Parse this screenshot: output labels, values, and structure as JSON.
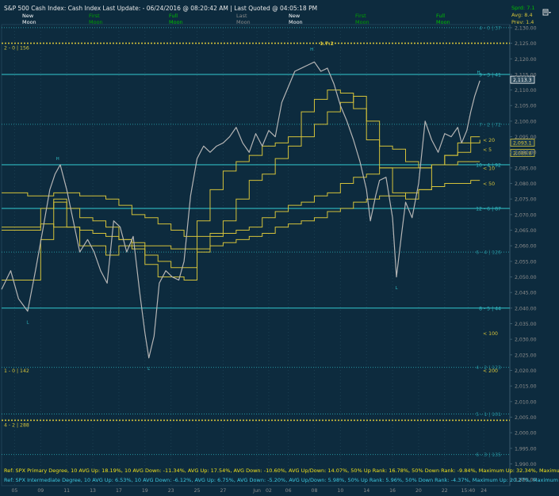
{
  "header": {
    "title": "S&P 500 Cash Index:  Cash Index  Last Update: - 06/24/2016 @ 08:20:42 AM | Last Quoted @ 04:05:18 PM",
    "menu_icon": "menu-list-icon",
    "stats": [
      "Sprd: 7.1",
      "Avg: 8.4",
      "Prev: 1.4"
    ]
  },
  "moon_phases": [
    {
      "top": "New",
      "bottom": "Moon",
      "color": "#ffffff"
    },
    {
      "top": "First",
      "bottom": "Moon",
      "color": "#00a000"
    },
    {
      "top": "Full",
      "bottom": "Moon",
      "color": "#00c000"
    },
    {
      "top": "Last",
      "bottom": "Moon",
      "color": "#8a8a8a"
    },
    {
      "top": "New",
      "bottom": "Moon",
      "color": "#ffffff"
    },
    {
      "top": "First",
      "bottom": "Moon",
      "color": "#00a000"
    },
    {
      "top": "Full",
      "bottom": "Moon",
      "color": "#00c000"
    }
  ],
  "colors": {
    "background": "#0d2b3e",
    "cyan": "#2fb8c0",
    "yellow": "#d4c23a",
    "price": "#b5b5b5",
    "axis_text": "#8c8c8c",
    "ref_primary": "#f0e01a",
    "ref_intermediate": "#3ec8e0"
  },
  "chart_data": {
    "type": "line",
    "title": "S&P 500 Cash Index",
    "ylim": [
      1983,
      2131
    ],
    "y_ticks": [
      2130,
      2125,
      2120,
      2115,
      2110,
      2105,
      2100,
      2095,
      2090,
      2085,
      2080,
      2075,
      2070,
      2065,
      2060,
      2055,
      2050,
      2045,
      2040,
      2035,
      2030,
      2025,
      2020,
      2015,
      2010,
      2005,
      2000,
      1995,
      1990,
      1985
    ],
    "x_ticks": [
      {
        "label": "05",
        "i": 1
      },
      {
        "label": "09",
        "i": 3
      },
      {
        "label": "11",
        "i": 5
      },
      {
        "label": "13",
        "i": 7
      },
      {
        "label": "17",
        "i": 9
      },
      {
        "label": "19",
        "i": 11
      },
      {
        "label": "23",
        "i": 13
      },
      {
        "label": "25",
        "i": 15
      },
      {
        "label": "27",
        "i": 17
      },
      {
        "label": "Jun",
        "i": 19.6
      },
      {
        "label": "02",
        "i": 20.5
      },
      {
        "label": "06",
        "i": 22
      },
      {
        "label": "08",
        "i": 24
      },
      {
        "label": "10",
        "i": 26
      },
      {
        "label": "14",
        "i": 28
      },
      {
        "label": "16",
        "i": 30
      },
      {
        "label": "20",
        "i": 32
      },
      {
        "label": "22",
        "i": 34
      },
      {
        "label": "15:40",
        "i": 35.8
      },
      {
        "label": "24",
        "i": 37
      }
    ],
    "index_range": [
      0,
      39
    ],
    "price_series": {
      "name": "Price",
      "points": [
        [
          0,
          2046
        ],
        [
          0.7,
          2052
        ],
        [
          1.3,
          2043
        ],
        [
          2,
          2039
        ],
        [
          2.6,
          2052
        ],
        [
          3.2,
          2066
        ],
        [
          3.7,
          2078
        ],
        [
          4.1,
          2083
        ],
        [
          4.5,
          2086
        ],
        [
          5,
          2078
        ],
        [
          5.5,
          2068
        ],
        [
          6,
          2058
        ],
        [
          6.6,
          2062
        ],
        [
          7.1,
          2058
        ],
        [
          7.6,
          2052
        ],
        [
          8.1,
          2048
        ],
        [
          8.6,
          2068
        ],
        [
          9.1,
          2066
        ],
        [
          9.6,
          2058
        ],
        [
          10.1,
          2063
        ],
        [
          10.6,
          2045
        ],
        [
          11,
          2032
        ],
        [
          11.3,
          2024
        ],
        [
          11.7,
          2031
        ],
        [
          12.1,
          2048
        ],
        [
          12.6,
          2052
        ],
        [
          13.1,
          2050
        ],
        [
          13.6,
          2049
        ],
        [
          14,
          2055
        ],
        [
          14.5,
          2076
        ],
        [
          15,
          2088
        ],
        [
          15.5,
          2092
        ],
        [
          16,
          2090
        ],
        [
          16.5,
          2092
        ],
        [
          17,
          2093
        ],
        [
          17.5,
          2095
        ],
        [
          18,
          2098
        ],
        [
          18.5,
          2093
        ],
        [
          19,
          2090
        ],
        [
          19.5,
          2096
        ],
        [
          20,
          2092
        ],
        [
          20.5,
          2097
        ],
        [
          21,
          2095
        ],
        [
          21.5,
          2106
        ],
        [
          22,
          2111
        ],
        [
          22.5,
          2116
        ],
        [
          23,
          2117
        ],
        [
          23.5,
          2118
        ],
        [
          24,
          2119
        ],
        [
          24.5,
          2116
        ],
        [
          25,
          2117
        ],
        [
          25.5,
          2112
        ],
        [
          26,
          2105
        ],
        [
          26.5,
          2100
        ],
        [
          27,
          2094
        ],
        [
          27.5,
          2087
        ],
        [
          28,
          2078
        ],
        [
          28.3,
          2068
        ],
        [
          28.7,
          2076
        ],
        [
          29,
          2081
        ],
        [
          29.5,
          2082
        ],
        [
          30,
          2069
        ],
        [
          30.3,
          2050
        ],
        [
          30.7,
          2064
        ],
        [
          31,
          2074
        ],
        [
          31.5,
          2069
        ],
        [
          32,
          2080
        ],
        [
          32.5,
          2100
        ],
        [
          33,
          2094
        ],
        [
          33.5,
          2090
        ],
        [
          34,
          2096
        ],
        [
          34.5,
          2095
        ],
        [
          35,
          2098
        ],
        [
          35.3,
          2093
        ],
        [
          35.7,
          2097
        ],
        [
          36,
          2103
        ],
        [
          36.3,
          2108
        ],
        [
          36.7,
          2113
        ]
      ],
      "labels": [
        {
          "text": "H",
          "i": 4.3,
          "y": 2087.3,
          "pos": "above"
        },
        {
          "text": "L",
          "i": 2,
          "y": 2036.5,
          "pos": "below"
        },
        {
          "text": "L",
          "i": 11.3,
          "y": 2021.7,
          "pos": "below"
        },
        {
          "text": "H",
          "i": 23.8,
          "y": 2122.4,
          "pos": "above"
        },
        {
          "text": "L",
          "i": 30.3,
          "y": 2047.6,
          "pos": "below"
        },
        {
          "text": "H",
          "i": 36.6,
          "y": 2115,
          "pos": "above"
        }
      ]
    },
    "moving_averages": [
      {
        "label": "< 5",
        "label_y": 2091.0,
        "points": [
          [
            0,
            2049
          ],
          [
            1,
            2049
          ],
          [
            2,
            2049
          ],
          [
            3,
            2062
          ],
          [
            4,
            2074
          ],
          [
            5,
            2066
          ],
          [
            6,
            2060
          ],
          [
            7,
            2060
          ],
          [
            8,
            2057
          ],
          [
            9,
            2060
          ],
          [
            10,
            2060
          ],
          [
            11,
            2054
          ],
          [
            12,
            2050
          ],
          [
            13,
            2050
          ],
          [
            14,
            2049
          ],
          [
            15,
            2068
          ],
          [
            16,
            2078
          ],
          [
            17,
            2084
          ],
          [
            18,
            2087
          ],
          [
            19,
            2089
          ],
          [
            20,
            2092
          ],
          [
            21,
            2093
          ],
          [
            22,
            2095
          ],
          [
            23,
            2103
          ],
          [
            24,
            2107
          ],
          [
            25,
            2110
          ],
          [
            26,
            2109
          ],
          [
            27,
            2104
          ],
          [
            28,
            2094
          ],
          [
            29,
            2085
          ],
          [
            30,
            2077
          ],
          [
            31,
            2075
          ],
          [
            32,
            2078
          ],
          [
            33,
            2086
          ],
          [
            34,
            2089
          ],
          [
            35,
            2093
          ],
          [
            36,
            2095
          ],
          [
            36.7,
            2095
          ]
        ]
      },
      {
        "label": "< 10",
        "label_y": 2085.0,
        "points": [
          [
            0,
            2065
          ],
          [
            1,
            2065
          ],
          [
            2,
            2065
          ],
          [
            3,
            2072
          ],
          [
            4,
            2075
          ],
          [
            5,
            2072
          ],
          [
            6,
            2069
          ],
          [
            7,
            2068
          ],
          [
            8,
            2066
          ],
          [
            9,
            2062
          ],
          [
            10,
            2059
          ],
          [
            11,
            2057
          ],
          [
            12,
            2055
          ],
          [
            13,
            2053
          ],
          [
            14,
            2053
          ],
          [
            15,
            2058
          ],
          [
            16,
            2063
          ],
          [
            17,
            2068
          ],
          [
            18,
            2075
          ],
          [
            19,
            2081
          ],
          [
            20,
            2083
          ],
          [
            21,
            2088
          ],
          [
            22,
            2092
          ],
          [
            23,
            2095
          ],
          [
            24,
            2099
          ],
          [
            25,
            2103
          ],
          [
            26,
            2106
          ],
          [
            27,
            2108
          ],
          [
            28,
            2100
          ],
          [
            29,
            2092
          ],
          [
            30,
            2091
          ],
          [
            31,
            2087
          ],
          [
            32,
            2085
          ],
          [
            33,
            2086
          ],
          [
            34,
            2086
          ],
          [
            35,
            2087
          ],
          [
            36,
            2087
          ],
          [
            36.7,
            2087
          ]
        ]
      },
      {
        "label": "< 20",
        "label_y": 2094.0,
        "points": [
          [
            0,
            2077
          ],
          [
            1,
            2077
          ],
          [
            2,
            2076
          ],
          [
            3,
            2076
          ],
          [
            4,
            2077
          ],
          [
            5,
            2077
          ],
          [
            6,
            2076
          ],
          [
            7,
            2076
          ],
          [
            8,
            2075
          ],
          [
            9,
            2073
          ],
          [
            10,
            2070
          ],
          [
            11,
            2069
          ],
          [
            12,
            2067
          ],
          [
            13,
            2065
          ],
          [
            14,
            2063
          ],
          [
            15,
            2063
          ],
          [
            16,
            2064
          ],
          [
            17,
            2064
          ],
          [
            18,
            2065
          ],
          [
            19,
            2066
          ],
          [
            20,
            2069
          ],
          [
            21,
            2071
          ],
          [
            22,
            2073
          ],
          [
            23,
            2074
          ],
          [
            24,
            2076
          ],
          [
            25,
            2077
          ],
          [
            26,
            2080
          ],
          [
            27,
            2082
          ],
          [
            28,
            2083
          ],
          [
            29,
            2085
          ],
          [
            30,
            2085
          ],
          [
            31,
            2085
          ],
          [
            32,
            2085
          ],
          [
            33,
            2086
          ],
          [
            34,
            2089
          ],
          [
            35,
            2090
          ],
          [
            36,
            2093
          ],
          [
            36.7,
            2094
          ]
        ]
      },
      {
        "label": "< 50",
        "label_y": 2080.0,
        "points": [
          [
            0,
            2066
          ],
          [
            1,
            2066
          ],
          [
            2,
            2066
          ],
          [
            3,
            2067
          ],
          [
            4,
            2066
          ],
          [
            5,
            2066
          ],
          [
            6,
            2065
          ],
          [
            7,
            2064
          ],
          [
            8,
            2063
          ],
          [
            9,
            2062
          ],
          [
            10,
            2061
          ],
          [
            11,
            2060
          ],
          [
            12,
            2060
          ],
          [
            13,
            2059
          ],
          [
            14,
            2059
          ],
          [
            15,
            2059
          ],
          [
            16,
            2060
          ],
          [
            17,
            2061
          ],
          [
            18,
            2062
          ],
          [
            19,
            2063
          ],
          [
            20,
            2064
          ],
          [
            21,
            2066
          ],
          [
            22,
            2067
          ],
          [
            23,
            2068
          ],
          [
            24,
            2069
          ],
          [
            25,
            2071
          ],
          [
            26,
            2072
          ],
          [
            27,
            2074
          ],
          [
            28,
            2075
          ],
          [
            29,
            2076
          ],
          [
            30,
            2076
          ],
          [
            31,
            2077
          ],
          [
            32,
            2078
          ],
          [
            33,
            2079
          ],
          [
            34,
            2080
          ],
          [
            35,
            2080
          ],
          [
            36,
            2081
          ],
          [
            36.7,
            2081
          ]
        ]
      }
    ],
    "cyan_levels": [
      {
        "label": "9 - 3 | 41",
        "y": 2115,
        "style": "solid"
      },
      {
        "label": "10 - 4 | 92",
        "y": 2086,
        "style": "solid"
      },
      {
        "label": "12 - 6 | 87",
        "y": 2072,
        "style": "solid"
      },
      {
        "label": "8 - 5 | 44",
        "y": 2040,
        "style": "solid"
      },
      {
        "label": "4 - 0 | 37",
        "y": 2130,
        "style": "dotted"
      },
      {
        "label": "7 - 2 | 72",
        "y": 2099,
        "style": "dotted"
      },
      {
        "label": "6 - 4 | 126",
        "y": 2058,
        "style": "dotted"
      },
      {
        "label": "4 - 2 | 123",
        "y": 2021,
        "style": "dotted"
      },
      {
        "label": "5 - 1 | 101",
        "y": 2006,
        "style": "dotted"
      },
      {
        "label": "6 - 3 | 135",
        "y": 1993,
        "style": "dotted"
      }
    ],
    "yellow_levels": [
      {
        "label": "2 - 0 | 156",
        "y": 2125,
        "style": "dotted"
      },
      {
        "label": "4 - 2 | 288",
        "y": 2004,
        "style": "dotted"
      }
    ],
    "level_markers": [
      {
        "label": "< 100",
        "y": 2032
      },
      {
        "label": "< 200",
        "y": 2020
      }
    ],
    "top_marker": "1.7.2",
    "price_labels": [
      {
        "text": "2,113.3",
        "y": 2113.3,
        "color": "#ffffff"
      },
      {
        "text": "2,093.1",
        "y": 2093.1,
        "color": "#d4c23a"
      },
      {
        "text": "2,089.8",
        "y": 2089.8,
        "color": "#d4c23a"
      }
    ],
    "left_labels": [
      {
        "text": "1 - 0 | 142",
        "y": 2020,
        "color": "#d4c23a"
      }
    ]
  },
  "references": [
    "Ref: SPX Primary Degree, 10 AVG Up: 18.19%, 10 AVG Down: -11.34%, AVG Up: 17.54%, AVG Down: -10.60%, AVG Up/Down: 14.07%, 50%  Up Rank: 16.78%, 50% Down Rank: -9.84%, Maximum Up: 32.34%, Maximum",
    "Ref: SPX Intermediate Degree, 10 AVG Up: 6.53%, 10 AVG Down: -6.12%, AVG Up: 6.75%, AVG Down: -5.20%, AVG Up/Down: 5.98%, 50%  Up Rank: 5.96%, 50% Down Rank: -4.37%, Maximum Up: 20.27%, Maximum Dc"
  ]
}
